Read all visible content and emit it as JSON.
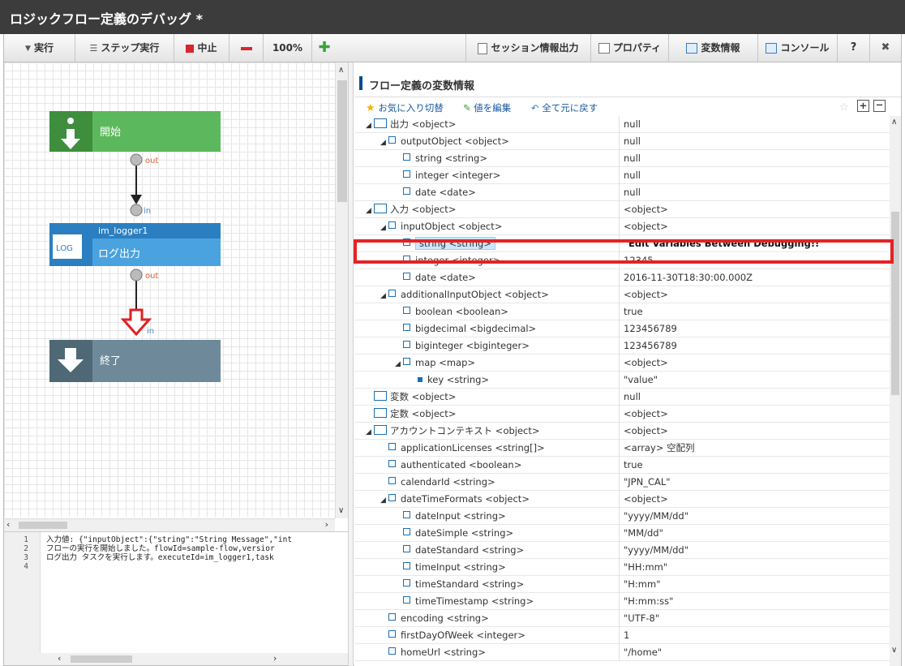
{
  "window": {
    "title": "ロジックフロー定義のデバッグ *"
  },
  "toolbar": {
    "run": "実行",
    "step_run": "ステップ実行",
    "stop": "中止",
    "zoom": "100%",
    "session_export": "セッション情報出力",
    "properties": "プロパティ",
    "variables": "変数情報",
    "console": "コンソール",
    "help": "?",
    "close": "✖"
  },
  "flow": {
    "start_label": "開始",
    "out_label": "out",
    "in_label": "in",
    "task_id": "im_logger1",
    "task_icon": "LOG",
    "task_label": "ログ出力",
    "out_label2": "out",
    "in_label2": "in",
    "end_label": "終了"
  },
  "console": {
    "lines": [
      {
        "num": "1",
        "text": "入力値: {\"inputObject\":{\"string\":\"String Message\",\"int"
      },
      {
        "num": "2",
        "text": "フローの実行を開始しました。flowId=sample-flow,versior"
      },
      {
        "num": "3",
        "text": "ログ出力 タスクを実行します。executeId=im_logger1,task"
      },
      {
        "num": "4",
        "text": ""
      }
    ]
  },
  "variables": {
    "title": "フロー定義の変数情報",
    "toolbar": {
      "favorite": "お気に入り切替",
      "edit": "値を編集",
      "reset": "全て元に戻す"
    },
    "rows": [
      {
        "indent": 0,
        "tri": "◢",
        "icon": "folder",
        "key": "出力 <object>",
        "value": "null"
      },
      {
        "indent": 1,
        "tri": "◢",
        "icon": "box",
        "key": "outputObject <object>",
        "value": "null"
      },
      {
        "indent": 2,
        "tri": "",
        "icon": "box",
        "key": "string <string>",
        "value": "null"
      },
      {
        "indent": 2,
        "tri": "",
        "icon": "box",
        "key": "integer <integer>",
        "value": "null"
      },
      {
        "indent": 2,
        "tri": "",
        "icon": "box",
        "key": "date <date>",
        "value": "null"
      },
      {
        "indent": 0,
        "tri": "◢",
        "icon": "folder",
        "key": "入力 <object>",
        "value": "<object>"
      },
      {
        "indent": 1,
        "tri": "◢",
        "icon": "box",
        "key": "inputObject <object>",
        "value": "<object>"
      },
      {
        "indent": 2,
        "tri": "",
        "icon": "box",
        "key": "string <string>",
        "value": "\"Edit Variables Between Debugging!!\"",
        "bold": true,
        "selected": true
      },
      {
        "indent": 2,
        "tri": "",
        "icon": "box",
        "key": "integer <integer>",
        "value": "12345"
      },
      {
        "indent": 2,
        "tri": "",
        "icon": "box",
        "key": "date <date>",
        "value": "2016-11-30T18:30:00.000Z"
      },
      {
        "indent": 1,
        "tri": "◢",
        "icon": "box",
        "key": "additionalInputObject <object>",
        "value": "<object>"
      },
      {
        "indent": 2,
        "tri": "",
        "icon": "box",
        "key": "boolean <boolean>",
        "value": "true"
      },
      {
        "indent": 2,
        "tri": "",
        "icon": "box",
        "key": "bigdecimal <bigdecimal>",
        "value": "123456789"
      },
      {
        "indent": 2,
        "tri": "",
        "icon": "box",
        "key": "biginteger <biginteger>",
        "value": "123456789"
      },
      {
        "indent": 2,
        "tri": "◢",
        "icon": "box",
        "key": "map <map>",
        "value": "<object>"
      },
      {
        "indent": 3,
        "tri": "",
        "icon": "sq",
        "key": "key <string>",
        "value": "\"value\""
      },
      {
        "indent": 0,
        "tri": "",
        "icon": "folder",
        "key": "変数 <object>",
        "value": "null"
      },
      {
        "indent": 0,
        "tri": "",
        "icon": "folder",
        "key": "定数 <object>",
        "value": "<object>"
      },
      {
        "indent": 0,
        "tri": "◢",
        "icon": "folder",
        "key": "アカウントコンテキスト <object>",
        "value": "<object>"
      },
      {
        "indent": 1,
        "tri": "",
        "icon": "box",
        "key": "applicationLicenses <string[]>",
        "value": "<array> 空配列"
      },
      {
        "indent": 1,
        "tri": "",
        "icon": "box",
        "key": "authenticated <boolean>",
        "value": "true"
      },
      {
        "indent": 1,
        "tri": "",
        "icon": "box",
        "key": "calendarId <string>",
        "value": "\"JPN_CAL\""
      },
      {
        "indent": 1,
        "tri": "◢",
        "icon": "box",
        "key": "dateTimeFormats <object>",
        "value": "<object>"
      },
      {
        "indent": 2,
        "tri": "",
        "icon": "box",
        "key": "dateInput <string>",
        "value": "\"yyyy/MM/dd\""
      },
      {
        "indent": 2,
        "tri": "",
        "icon": "box",
        "key": "dateSimple <string>",
        "value": "\"MM/dd\""
      },
      {
        "indent": 2,
        "tri": "",
        "icon": "box",
        "key": "dateStandard <string>",
        "value": "\"yyyy/MM/dd\""
      },
      {
        "indent": 2,
        "tri": "",
        "icon": "box",
        "key": "timeInput <string>",
        "value": "\"HH:mm\""
      },
      {
        "indent": 2,
        "tri": "",
        "icon": "box",
        "key": "timeStandard <string>",
        "value": "\"H:mm\""
      },
      {
        "indent": 2,
        "tri": "",
        "icon": "box",
        "key": "timeTimestamp <string>",
        "value": "\"H:mm:ss\""
      },
      {
        "indent": 1,
        "tri": "",
        "icon": "box",
        "key": "encoding <string>",
        "value": "\"UTF-8\""
      },
      {
        "indent": 1,
        "tri": "",
        "icon": "box",
        "key": "firstDayOfWeek <integer>",
        "value": "1"
      },
      {
        "indent": 1,
        "tri": "",
        "icon": "box",
        "key": "homeUrl <string>",
        "value": "\"/home\""
      }
    ]
  },
  "colors": {
    "start": "#5cb85c",
    "start_dark": "#3e8e3e",
    "task": "#4aa3df",
    "task_dark": "#2b7fc0",
    "end": "#6e8a9a",
    "end_dark": "#4e6876",
    "highlight": "#e52222",
    "accent": "#1a5aa0"
  }
}
